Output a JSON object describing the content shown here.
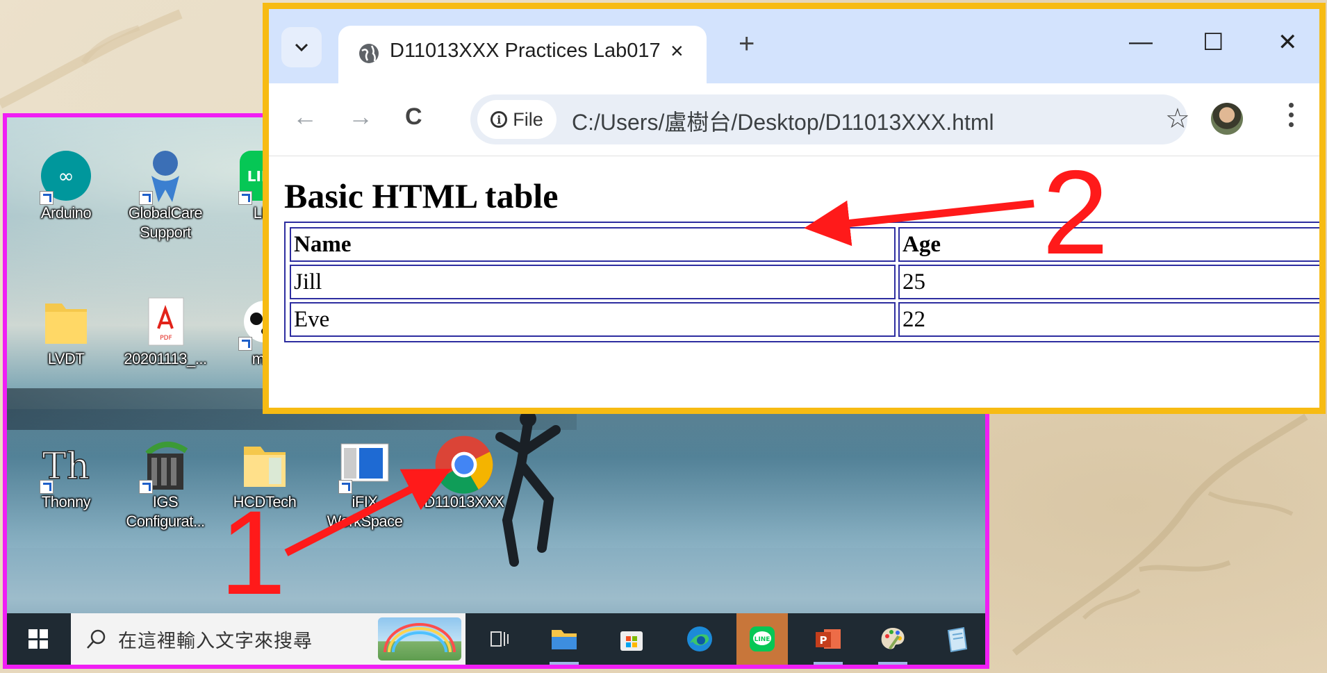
{
  "desktop": {
    "icons": [
      {
        "name": "Arduino",
        "label": "Arduino"
      },
      {
        "name": "GlobalCare Support",
        "label": "GlobalCare Support"
      },
      {
        "name": "LINE",
        "label": "LIN"
      },
      {
        "name": "LVDT",
        "label": "LVDT"
      },
      {
        "name": "20201113",
        "label": "20201113_..."
      },
      {
        "name": "mBlock",
        "label": "mBl"
      },
      {
        "name": "Thonny",
        "label": "Thonny"
      },
      {
        "name": "IGS Configurator",
        "label": "IGS Configurat..."
      },
      {
        "name": "HCDTech",
        "label": "HCDTech"
      },
      {
        "name": "iFIX WorkSpace",
        "label": "iFIX WorkSpace"
      },
      {
        "name": "D11013XXX",
        "label": "D11013XXX"
      }
    ]
  },
  "taskbar": {
    "search_placeholder": "在這裡輸入文字來搜尋",
    "items": [
      "task-view",
      "file-explorer",
      "microsoft-store",
      "edge",
      "line",
      "powerpoint",
      "paint",
      "notepad"
    ]
  },
  "browser": {
    "tab_title": "D11013XXX Practices Lab017",
    "tab_close": "×",
    "new_tab": "+",
    "minimize": "—",
    "maximize": "☐",
    "close": "✕",
    "back": "←",
    "forward": "→",
    "reload": "C",
    "chip_label": "File",
    "url": "C:/Users/盧樹台/Desktop/D11013XXX.html",
    "bookmark_star": "☆"
  },
  "page": {
    "heading": "Basic HTML table",
    "table": {
      "headers": [
        "Name",
        "Age"
      ],
      "rows": [
        [
          "Jill",
          "25"
        ],
        [
          "Eve",
          "22"
        ]
      ]
    }
  },
  "annotations": {
    "one": "1",
    "two": "2"
  },
  "colors": {
    "desktop_frame": "#f01ef4",
    "browser_frame": "#f7bb13",
    "annotation": "#ff1a1a",
    "tabstrip": "#d3e3fd"
  }
}
